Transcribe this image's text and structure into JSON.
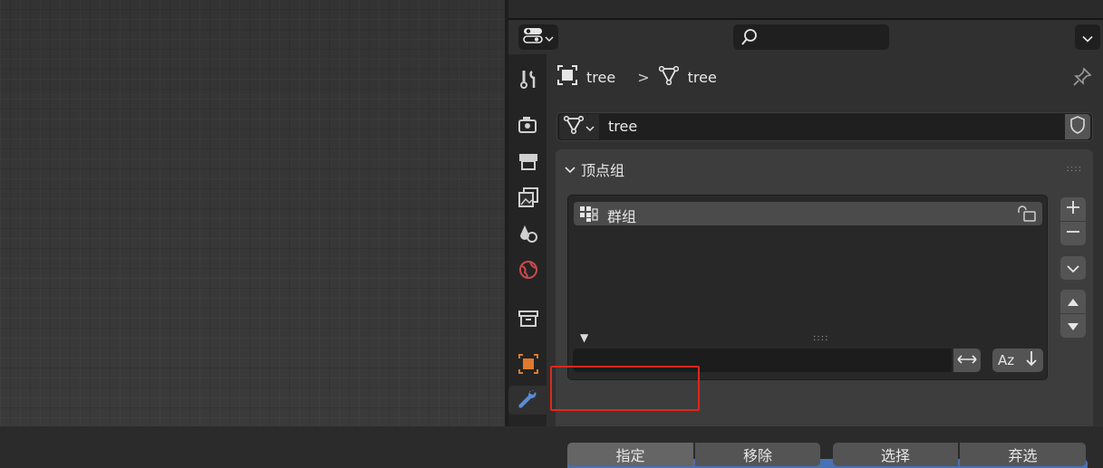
{
  "header": {
    "editor_type_icon": "properties-editor-icon",
    "search_placeholder": "",
    "search_icon": "search-icon",
    "options_icon": "chevron-down-icon"
  },
  "sidebar_tabs": [
    {
      "name": "tool",
      "icon": "tool-icon"
    },
    {
      "name": "render",
      "icon": "render-icon"
    },
    {
      "name": "output",
      "icon": "output-icon"
    },
    {
      "name": "view-layer",
      "icon": "view-layer-icon"
    },
    {
      "name": "scene",
      "icon": "scene-icon"
    },
    {
      "name": "world",
      "icon": "world-icon"
    },
    {
      "name": "collection",
      "icon": "collection-icon"
    },
    {
      "name": "object",
      "icon": "object-icon"
    },
    {
      "name": "modifiers",
      "icon": "wrench-icon",
      "active": true
    }
  ],
  "breadcrumb": {
    "object_name": "tree",
    "separator": ">",
    "mesh_name": "tree"
  },
  "datablock": {
    "name": "tree"
  },
  "panel": {
    "title": "顶点组",
    "list": {
      "items": [
        {
          "label": "群组",
          "locked": false
        }
      ]
    },
    "filter": {
      "value": "",
      "sort_label": "Az"
    }
  },
  "buttons": {
    "assign": "指定",
    "remove": "移除",
    "select": "选择",
    "deselect": "弃选"
  },
  "colors": {
    "highlight": "#e0261c",
    "accent_blue": "#4772b3",
    "object_orange": "#e07a2f"
  }
}
